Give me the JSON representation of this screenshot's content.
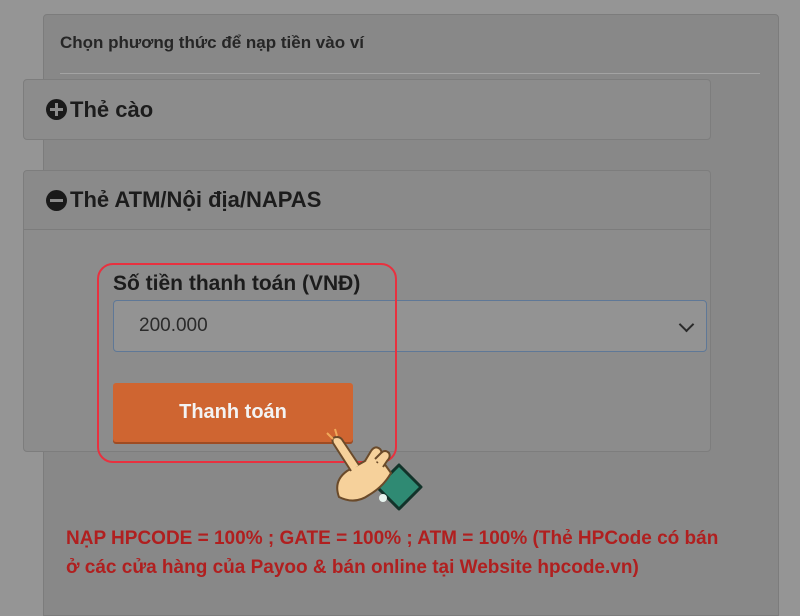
{
  "panel": {
    "title": "Chọn phương thức để nạp tiền vào ví"
  },
  "accordion": [
    {
      "label": "Thẻ cào",
      "icon": "plus-circle-icon",
      "expanded": false
    },
    {
      "label": "Thẻ ATM/Nội địa/NAPAS",
      "icon": "minus-circle-icon",
      "expanded": true
    }
  ],
  "atm_form": {
    "amount_label": "Số tiền thanh toán (VNĐ)",
    "amount_value": "200.000",
    "pay_button": "Thanh toán"
  },
  "notice": {
    "line1": "NẠP HPCODE = 100% ; GATE = 100% ; ATM = 100% (Thẻ HPCode có bán",
    "line2": "ở các cửa hàng của Payoo & bán online tại Website hpcode.vn)"
  },
  "colors": {
    "accent_button": "#cf6531",
    "highlight_border": "#e8313f",
    "notice_text": "#b01f1f"
  }
}
